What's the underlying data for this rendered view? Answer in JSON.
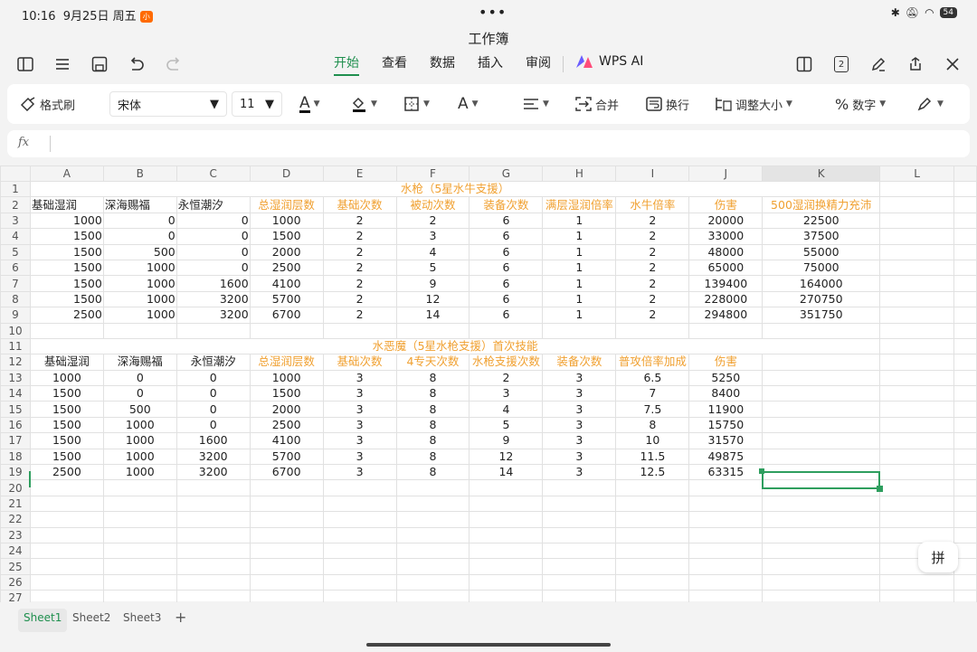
{
  "status": {
    "time": "10:16",
    "date": "9月25日 周五",
    "badge": "小",
    "dots": "•••",
    "battery": "54"
  },
  "app": {
    "title": "工作簿"
  },
  "topbar": {
    "tabs": [
      {
        "label": "开始",
        "active": true
      },
      {
        "label": "查看",
        "active": false
      },
      {
        "label": "数据",
        "active": false
      },
      {
        "label": "插入",
        "active": false
      },
      {
        "label": "审阅",
        "active": false
      }
    ],
    "ai_label": "WPS AI",
    "page_badge": "2"
  },
  "toolbar": {
    "format_painter": "格式刷",
    "font_name": "宋体",
    "font_size": "11",
    "merge": "合并",
    "wrap": "换行",
    "resize": "调整大小",
    "number": "数字"
  },
  "formula": {
    "label": "fx",
    "value": ""
  },
  "grid": {
    "columns": [
      "A",
      "B",
      "C",
      "D",
      "E",
      "F",
      "G",
      "H",
      "I",
      "J",
      "K",
      "L"
    ],
    "selected_column": "K",
    "rows": [
      {
        "n": "1",
        "cells": [
          {
            "col": 1,
            "span": 11,
            "v": "水枪（5星水牛支援）",
            "a": "c",
            "o": true
          }
        ]
      },
      {
        "n": "2",
        "cells": [
          {
            "v": "基础湿润"
          },
          {
            "v": "深海赐福"
          },
          {
            "v": "永恒潮汐"
          },
          {
            "v": "总湿润层数",
            "a": "c",
            "o": true
          },
          {
            "v": "基础次数",
            "a": "c",
            "o": true
          },
          {
            "v": "被动次数",
            "a": "c",
            "o": true
          },
          {
            "v": "装备次数",
            "a": "c",
            "o": true
          },
          {
            "v": "满层湿润倍率",
            "a": "c",
            "o": true
          },
          {
            "v": "水牛倍率",
            "a": "c",
            "o": true
          },
          {
            "v": "伤害",
            "a": "c",
            "o": true
          },
          {
            "v": "500湿润换精力充沛",
            "a": "c",
            "o": true
          },
          {
            "v": ""
          }
        ]
      },
      {
        "n": "3",
        "cells": [
          {
            "v": "1000",
            "a": "r"
          },
          {
            "v": "0",
            "a": "r"
          },
          {
            "v": "0",
            "a": "r"
          },
          {
            "v": "1000",
            "a": "c"
          },
          {
            "v": "2",
            "a": "c"
          },
          {
            "v": "2",
            "a": "c"
          },
          {
            "v": "6",
            "a": "c"
          },
          {
            "v": "1",
            "a": "c"
          },
          {
            "v": "2",
            "a": "c"
          },
          {
            "v": "20000",
            "a": "c"
          },
          {
            "v": "22500",
            "a": "c"
          },
          {
            "v": ""
          }
        ]
      },
      {
        "n": "4",
        "cells": [
          {
            "v": "1500",
            "a": "r"
          },
          {
            "v": "0",
            "a": "r"
          },
          {
            "v": "0",
            "a": "r"
          },
          {
            "v": "1500",
            "a": "c"
          },
          {
            "v": "2",
            "a": "c"
          },
          {
            "v": "3",
            "a": "c"
          },
          {
            "v": "6",
            "a": "c"
          },
          {
            "v": "1",
            "a": "c"
          },
          {
            "v": "2",
            "a": "c"
          },
          {
            "v": "33000",
            "a": "c"
          },
          {
            "v": "37500",
            "a": "c"
          },
          {
            "v": ""
          }
        ]
      },
      {
        "n": "5",
        "cells": [
          {
            "v": "1500",
            "a": "r"
          },
          {
            "v": "500",
            "a": "r"
          },
          {
            "v": "0",
            "a": "r"
          },
          {
            "v": "2000",
            "a": "c"
          },
          {
            "v": "2",
            "a": "c"
          },
          {
            "v": "4",
            "a": "c"
          },
          {
            "v": "6",
            "a": "c"
          },
          {
            "v": "1",
            "a": "c"
          },
          {
            "v": "2",
            "a": "c"
          },
          {
            "v": "48000",
            "a": "c"
          },
          {
            "v": "55000",
            "a": "c"
          },
          {
            "v": ""
          }
        ]
      },
      {
        "n": "6",
        "cells": [
          {
            "v": "1500",
            "a": "r"
          },
          {
            "v": "1000",
            "a": "r"
          },
          {
            "v": "0",
            "a": "r"
          },
          {
            "v": "2500",
            "a": "c"
          },
          {
            "v": "2",
            "a": "c"
          },
          {
            "v": "5",
            "a": "c"
          },
          {
            "v": "6",
            "a": "c"
          },
          {
            "v": "1",
            "a": "c"
          },
          {
            "v": "2",
            "a": "c"
          },
          {
            "v": "65000",
            "a": "c"
          },
          {
            "v": "75000",
            "a": "c"
          },
          {
            "v": ""
          }
        ]
      },
      {
        "n": "7",
        "cells": [
          {
            "v": "1500",
            "a": "r"
          },
          {
            "v": "1000",
            "a": "r"
          },
          {
            "v": "1600",
            "a": "r"
          },
          {
            "v": "4100",
            "a": "c"
          },
          {
            "v": "2",
            "a": "c"
          },
          {
            "v": "9",
            "a": "c"
          },
          {
            "v": "6",
            "a": "c"
          },
          {
            "v": "1",
            "a": "c"
          },
          {
            "v": "2",
            "a": "c"
          },
          {
            "v": "139400",
            "a": "c"
          },
          {
            "v": "164000",
            "a": "c"
          },
          {
            "v": ""
          }
        ]
      },
      {
        "n": "8",
        "cells": [
          {
            "v": "1500",
            "a": "r"
          },
          {
            "v": "1000",
            "a": "r"
          },
          {
            "v": "3200",
            "a": "r"
          },
          {
            "v": "5700",
            "a": "c"
          },
          {
            "v": "2",
            "a": "c"
          },
          {
            "v": "12",
            "a": "c"
          },
          {
            "v": "6",
            "a": "c"
          },
          {
            "v": "1",
            "a": "c"
          },
          {
            "v": "2",
            "a": "c"
          },
          {
            "v": "228000",
            "a": "c"
          },
          {
            "v": "270750",
            "a": "c"
          },
          {
            "v": ""
          }
        ]
      },
      {
        "n": "9",
        "cells": [
          {
            "v": "2500",
            "a": "r"
          },
          {
            "v": "1000",
            "a": "r"
          },
          {
            "v": "3200",
            "a": "r"
          },
          {
            "v": "6700",
            "a": "c"
          },
          {
            "v": "2",
            "a": "c"
          },
          {
            "v": "14",
            "a": "c"
          },
          {
            "v": "6",
            "a": "c"
          },
          {
            "v": "1",
            "a": "c"
          },
          {
            "v": "2",
            "a": "c"
          },
          {
            "v": "294800",
            "a": "c"
          },
          {
            "v": "351750",
            "a": "c"
          },
          {
            "v": ""
          }
        ]
      },
      {
        "n": "10",
        "cells": []
      },
      {
        "n": "11",
        "cells": [
          {
            "col": 1,
            "span": 11,
            "v": "水恶魔（5星水枪支援）首次技能",
            "a": "c",
            "o": true
          }
        ]
      },
      {
        "n": "12",
        "cells": [
          {
            "v": "基础湿润",
            "a": "c"
          },
          {
            "v": "深海赐福",
            "a": "c"
          },
          {
            "v": "永恒潮汐",
            "a": "c"
          },
          {
            "v": "总湿润层数",
            "a": "c",
            "o": true
          },
          {
            "v": "基础次数",
            "a": "c",
            "o": true
          },
          {
            "v": "4专天次数",
            "a": "c",
            "o": true
          },
          {
            "v": "水枪支援次数",
            "a": "c",
            "o": true
          },
          {
            "v": "装备次数",
            "a": "c",
            "o": true
          },
          {
            "v": "普攻倍率加成",
            "a": "c",
            "o": true
          },
          {
            "v": "伤害",
            "a": "c",
            "o": true
          },
          {
            "v": ""
          },
          {
            "v": ""
          }
        ]
      },
      {
        "n": "13",
        "cells": [
          {
            "v": "1000",
            "a": "c"
          },
          {
            "v": "0",
            "a": "c"
          },
          {
            "v": "0",
            "a": "c"
          },
          {
            "v": "1000",
            "a": "c"
          },
          {
            "v": "3",
            "a": "c"
          },
          {
            "v": "8",
            "a": "c"
          },
          {
            "v": "2",
            "a": "c"
          },
          {
            "v": "3",
            "a": "c"
          },
          {
            "v": "6.5",
            "a": "c"
          },
          {
            "v": "5250",
            "a": "c"
          },
          {
            "v": ""
          },
          {
            "v": ""
          }
        ]
      },
      {
        "n": "14",
        "cells": [
          {
            "v": "1500",
            "a": "c"
          },
          {
            "v": "0",
            "a": "c"
          },
          {
            "v": "0",
            "a": "c"
          },
          {
            "v": "1500",
            "a": "c"
          },
          {
            "v": "3",
            "a": "c"
          },
          {
            "v": "8",
            "a": "c"
          },
          {
            "v": "3",
            "a": "c"
          },
          {
            "v": "3",
            "a": "c"
          },
          {
            "v": "7",
            "a": "c"
          },
          {
            "v": "8400",
            "a": "c"
          },
          {
            "v": ""
          },
          {
            "v": ""
          }
        ]
      },
      {
        "n": "15",
        "cells": [
          {
            "v": "1500",
            "a": "c"
          },
          {
            "v": "500",
            "a": "c"
          },
          {
            "v": "0",
            "a": "c"
          },
          {
            "v": "2000",
            "a": "c"
          },
          {
            "v": "3",
            "a": "c"
          },
          {
            "v": "8",
            "a": "c"
          },
          {
            "v": "4",
            "a": "c"
          },
          {
            "v": "3",
            "a": "c"
          },
          {
            "v": "7.5",
            "a": "c"
          },
          {
            "v": "11900",
            "a": "c"
          },
          {
            "v": ""
          },
          {
            "v": ""
          }
        ]
      },
      {
        "n": "16",
        "cells": [
          {
            "v": "1500",
            "a": "c"
          },
          {
            "v": "1000",
            "a": "c"
          },
          {
            "v": "0",
            "a": "c"
          },
          {
            "v": "2500",
            "a": "c"
          },
          {
            "v": "3",
            "a": "c"
          },
          {
            "v": "8",
            "a": "c"
          },
          {
            "v": "5",
            "a": "c"
          },
          {
            "v": "3",
            "a": "c"
          },
          {
            "v": "8",
            "a": "c"
          },
          {
            "v": "15750",
            "a": "c"
          },
          {
            "v": ""
          },
          {
            "v": ""
          }
        ]
      },
      {
        "n": "17",
        "cells": [
          {
            "v": "1500",
            "a": "c"
          },
          {
            "v": "1000",
            "a": "c"
          },
          {
            "v": "1600",
            "a": "c"
          },
          {
            "v": "4100",
            "a": "c"
          },
          {
            "v": "3",
            "a": "c"
          },
          {
            "v": "8",
            "a": "c"
          },
          {
            "v": "9",
            "a": "c"
          },
          {
            "v": "3",
            "a": "c"
          },
          {
            "v": "10",
            "a": "c"
          },
          {
            "v": "31570",
            "a": "c"
          },
          {
            "v": ""
          },
          {
            "v": ""
          }
        ]
      },
      {
        "n": "18",
        "cells": [
          {
            "v": "1500",
            "a": "c"
          },
          {
            "v": "1000",
            "a": "c"
          },
          {
            "v": "3200",
            "a": "c"
          },
          {
            "v": "5700",
            "a": "c"
          },
          {
            "v": "3",
            "a": "c"
          },
          {
            "v": "8",
            "a": "c"
          },
          {
            "v": "12",
            "a": "c"
          },
          {
            "v": "3",
            "a": "c"
          },
          {
            "v": "11.5",
            "a": "c"
          },
          {
            "v": "49875",
            "a": "c"
          },
          {
            "v": ""
          },
          {
            "v": ""
          }
        ]
      },
      {
        "n": "19",
        "cells": [
          {
            "v": "2500",
            "a": "c"
          },
          {
            "v": "1000",
            "a": "c"
          },
          {
            "v": "3200",
            "a": "c"
          },
          {
            "v": "6700",
            "a": "c"
          },
          {
            "v": "3",
            "a": "c"
          },
          {
            "v": "8",
            "a": "c"
          },
          {
            "v": "14",
            "a": "c"
          },
          {
            "v": "3",
            "a": "c"
          },
          {
            "v": "12.5",
            "a": "c"
          },
          {
            "v": "63315",
            "a": "c"
          },
          {
            "v": ""
          },
          {
            "v": ""
          }
        ]
      },
      {
        "n": "20",
        "cells": []
      },
      {
        "n": "21",
        "cells": []
      },
      {
        "n": "22",
        "cells": []
      },
      {
        "n": "23",
        "cells": []
      },
      {
        "n": "24",
        "cells": []
      },
      {
        "n": "25",
        "cells": []
      },
      {
        "n": "26",
        "cells": []
      },
      {
        "n": "27",
        "cells": []
      }
    ]
  },
  "ime": {
    "label": "拼"
  },
  "sheets": [
    {
      "label": "Sheet1",
      "active": true
    },
    {
      "label": "Sheet2",
      "active": false
    },
    {
      "label": "Sheet3",
      "active": false
    }
  ],
  "add_sheet": "+"
}
